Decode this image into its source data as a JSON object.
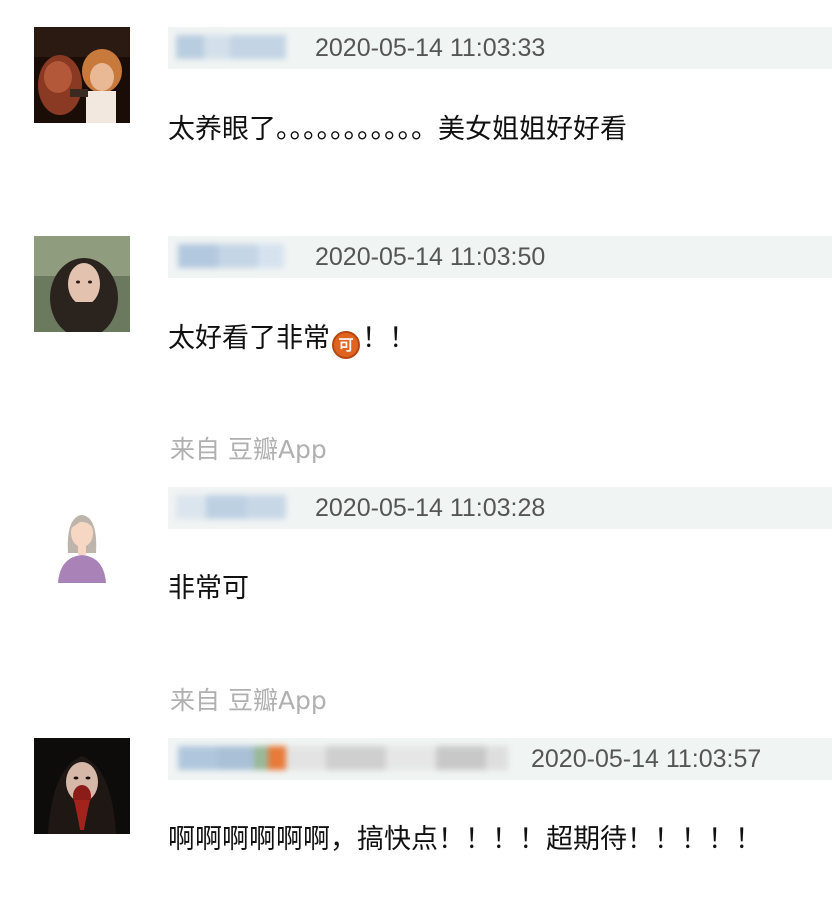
{
  "comments": [
    {
      "username": "",
      "timestamp": "2020-05-14 11:03:33",
      "text": "太养眼了。。。。。。。。。。。美女姐姐好好看",
      "avatar": "avatar-photo-icon"
    },
    {
      "username": "",
      "timestamp": "2020-05-14 11:03:50",
      "text_before": "太好看了非常",
      "emoji_label": "可",
      "text_after": "！！",
      "avatar": "avatar-photo-icon"
    },
    {
      "username": "",
      "timestamp": "2020-05-14 11:03:28",
      "text": "非常可",
      "avatar": "avatar-illustration-icon"
    },
    {
      "username": "",
      "timestamp": "2020-05-14 11:03:57",
      "text": "啊啊啊啊啊啊，搞快点！！！！超期待！！！！！",
      "avatar": "avatar-photo-icon"
    }
  ],
  "sources": [
    "来自 豆瓣App",
    "来自 豆瓣App"
  ],
  "colors": {
    "meta_bar": "#f0f4f3",
    "timestamp": "#555555",
    "source_text": "#b0b0b0",
    "emoji_badge": "#e0631f"
  }
}
